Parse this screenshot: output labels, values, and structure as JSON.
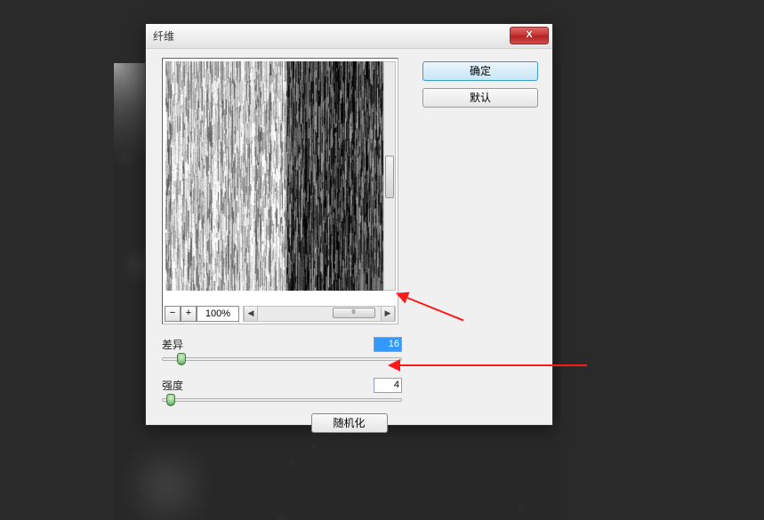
{
  "dialog": {
    "title": "纤维",
    "close_label": "X",
    "preview": {
      "zoom_minus": "−",
      "zoom_plus": "+",
      "zoom_value": "100%",
      "hscroll_left": "◀",
      "hscroll_right": "▶",
      "hscroll_thumb": "Ⅲ"
    },
    "buttons": {
      "ok": "确定",
      "default": "默认"
    },
    "sliders": {
      "variance": {
        "label": "差异",
        "value": "16"
      },
      "strength": {
        "label": "强度",
        "value": "4"
      }
    },
    "randomize": "随机化"
  }
}
